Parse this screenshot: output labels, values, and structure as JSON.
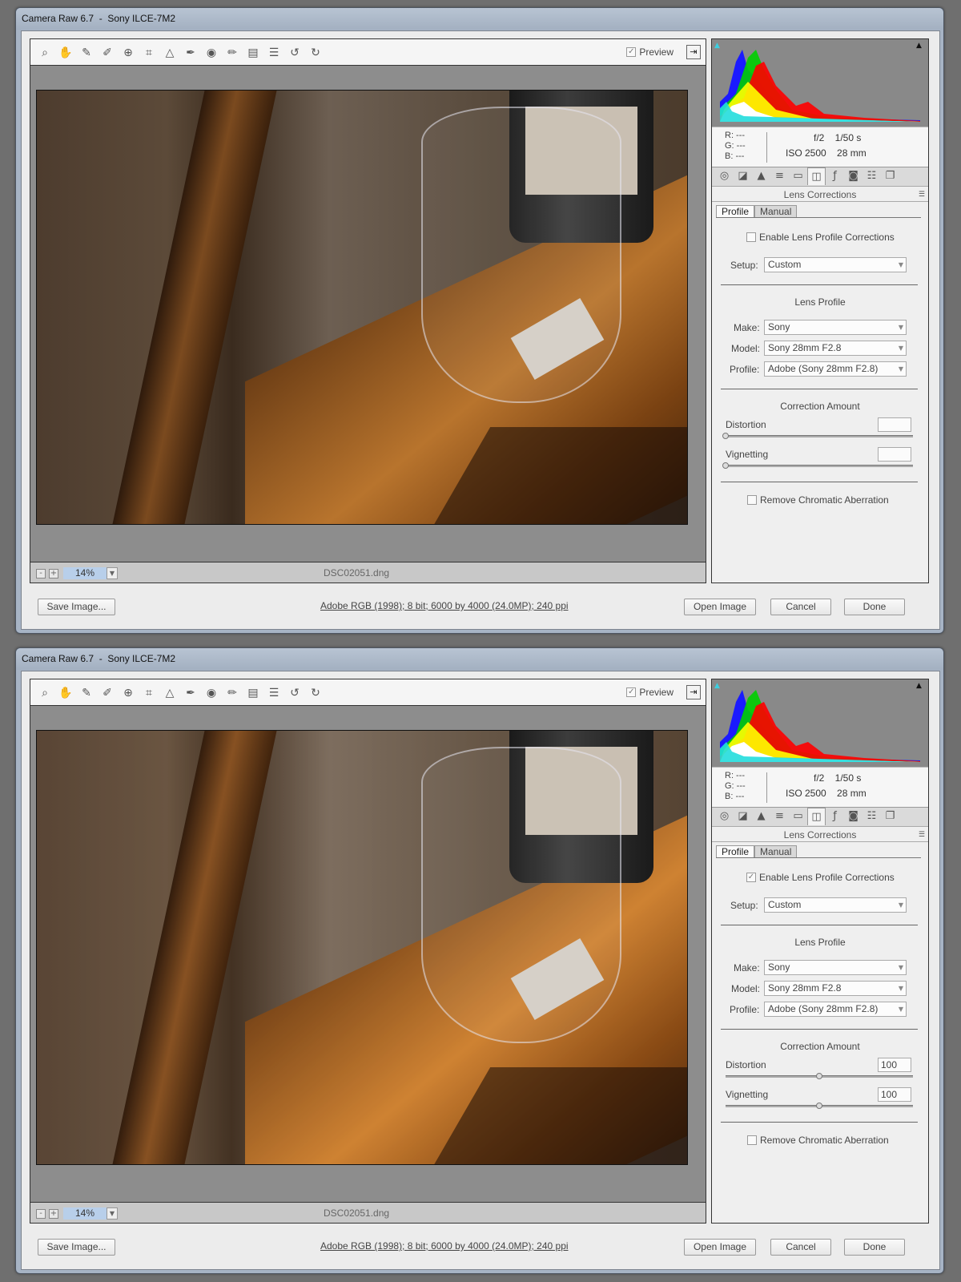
{
  "windows": [
    {
      "title": "Camera Raw 6.7  -  Sony ILCE-7M2",
      "toolbar": {
        "preview_label": "Preview",
        "preview_checked": true
      },
      "status": {
        "zoom": "14%",
        "filename": "DSC02051.dng",
        "zoom_out": "-",
        "zoom_in": "+"
      },
      "readout": {
        "r": "R:   ---",
        "g": "G:   ---",
        "b": "B:   ---",
        "aperture_shutter": "f/2    1/50 s",
        "iso_focal": "ISO 2500    28 mm"
      },
      "panel": {
        "title": "Lens Corrections",
        "tabs": [
          "Profile",
          "Manual"
        ],
        "enable_label": "Enable Lens Profile Corrections",
        "enable_checked": false,
        "setup_label": "Setup:",
        "setup_value": "Custom",
        "lens_profile_title": "Lens Profile",
        "make_label": "Make:",
        "make_value": "Sony",
        "model_label": "Model:",
        "model_value": "Sony 28mm F2.8",
        "profile_label": "Profile:",
        "profile_value": "Adobe (Sony 28mm F2.8)",
        "correction_title": "Correction Amount",
        "distortion_label": "Distortion",
        "distortion_value": "",
        "distortion_level": 0,
        "vignetting_label": "Vignetting",
        "vignetting_value": "",
        "vignetting_level": 0,
        "chromatic_label": "Remove Chromatic Aberration",
        "chromatic_checked": false
      },
      "footer": {
        "save_label": "Save Image...",
        "image_info": "Adobe RGB (1998); 8 bit; 6000 by 4000 (24.0MP); 240 ppi",
        "open_label": "Open Image",
        "cancel_label": "Cancel",
        "done_label": "Done"
      },
      "photo_corrected": false
    },
    {
      "title": "Camera Raw 6.7  -  Sony ILCE-7M2",
      "toolbar": {
        "preview_label": "Preview",
        "preview_checked": true
      },
      "status": {
        "zoom": "14%",
        "filename": "DSC02051.dng",
        "zoom_out": "-",
        "zoom_in": "+"
      },
      "readout": {
        "r": "R:   ---",
        "g": "G:   ---",
        "b": "B:   ---",
        "aperture_shutter": "f/2    1/50 s",
        "iso_focal": "ISO 2500    28 mm"
      },
      "panel": {
        "title": "Lens Corrections",
        "tabs": [
          "Profile",
          "Manual"
        ],
        "enable_label": "Enable Lens Profile Corrections",
        "enable_checked": true,
        "setup_label": "Setup:",
        "setup_value": "Custom",
        "lens_profile_title": "Lens Profile",
        "make_label": "Make:",
        "make_value": "Sony",
        "model_label": "Model:",
        "model_value": "Sony 28mm F2.8",
        "profile_label": "Profile:",
        "profile_value": "Adobe (Sony 28mm F2.8)",
        "correction_title": "Correction Amount",
        "distortion_label": "Distortion",
        "distortion_value": "100",
        "distortion_level": 0.5,
        "vignetting_label": "Vignetting",
        "vignetting_value": "100",
        "vignetting_level": 0.5,
        "chromatic_label": "Remove Chromatic Aberration",
        "chromatic_checked": false
      },
      "footer": {
        "save_label": "Save Image...",
        "image_info": "Adobe RGB (1998); 8 bit; 6000 by 4000 (24.0MP); 240 ppi",
        "open_label": "Open Image",
        "cancel_label": "Cancel",
        "done_label": "Done"
      },
      "photo_corrected": true
    }
  ],
  "icons": {
    "tools": [
      "zoom-icon",
      "hand-icon",
      "white-balance-icon",
      "color-sampler-icon",
      "target-adjustment-icon",
      "crop-icon",
      "straighten-icon",
      "spot-removal-icon",
      "red-eye-icon",
      "adjustment-brush-icon",
      "graduated-filter-icon",
      "preferences-icon",
      "rotate-ccw-icon",
      "rotate-cw-icon"
    ],
    "panel_tabs": [
      "basic-icon",
      "tone-curve-icon",
      "detail-icon",
      "hsl-icon",
      "split-toning-icon",
      "lens-corrections-icon",
      "effects-icon",
      "camera-calibration-icon",
      "presets-icon",
      "snapshots-icon"
    ]
  }
}
